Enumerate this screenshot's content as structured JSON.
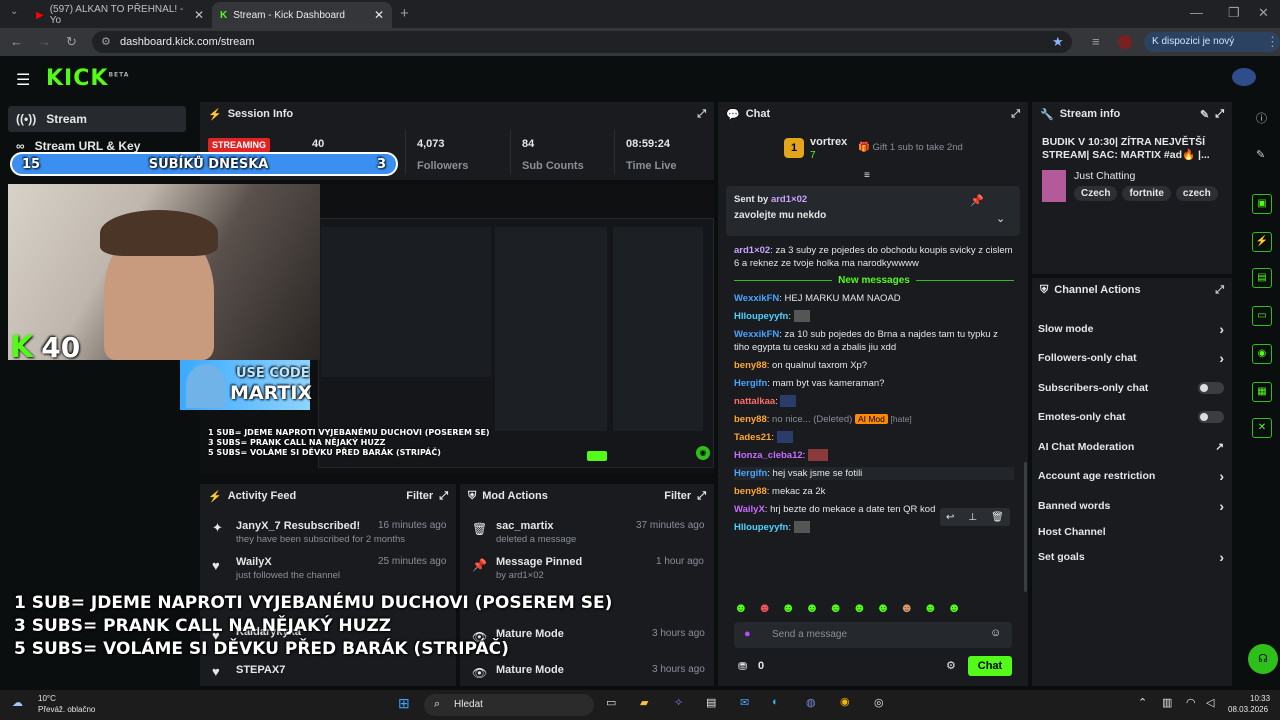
{
  "browser": {
    "tabs": [
      {
        "label": "(597) ALKAN TO PŘEHNAL! - Yo"
      },
      {
        "label": "Stream - Kick Dashboard"
      }
    ],
    "url": "dashboard.kick.com/stream",
    "profile_label": "K dispozici je nový Chrome"
  },
  "sidebar": {
    "items": [
      {
        "label": "Stream"
      },
      {
        "label": "Stream URL & Key"
      }
    ]
  },
  "session": {
    "title": "Session Info",
    "status": "STREAMING",
    "viewers": "40",
    "followers_value": "4,073",
    "followers_label": "Followers",
    "subs_value": "84",
    "subs_label": "Sub Counts",
    "time_value": "08:59:24",
    "time_label": "Time Live"
  },
  "overlay": {
    "sub_goal_left": "15",
    "sub_goal_label": "SUBÍKŮ DNESKA",
    "sub_goal_right": "3",
    "viewer_count": "40",
    "code_line1": "USE CODE",
    "code_line2": "MARTIX",
    "goals": [
      "1 SUB= JDEME NAPROTI VYJEBANÉMU DUCHOVI (POSEREM SE)",
      "3 SUBS= PRANK CALL NA NĚJAKÝ HUZZ",
      "5 SUBS= VOLÁME SI DĚVKU PŘED BARÁK (STRIPÁČ)"
    ],
    "mini_goals": [
      "1 SUB= JDEME NAPROTI VYJEBANÉMU DUCHOVI (POSEREM SE)",
      "3 SUBS= PRANK CALL NA NĚJAKÝ HUZZ",
      "5 SUBS= VOLÁME SI DĚVKU PŘED BARÁK (STRIPÁČ)"
    ]
  },
  "activity": {
    "title": "Activity Feed",
    "filter": "Filter",
    "items": [
      {
        "name": "JanyX_7 Resubscribed!",
        "time": "16 minutes ago",
        "detail": "they have been subscribed for 2 months"
      },
      {
        "name": "WailyX",
        "time": "25 minutes ago",
        "detail": "just followed the channel"
      },
      {
        "name": "Kaldarykyka",
        "time": "",
        "detail": "just followed the channel"
      },
      {
        "name": "STEPAX7",
        "time": "",
        "detail": ""
      }
    ]
  },
  "modactions": {
    "title": "Mod Actions",
    "filter": "Filter",
    "items": [
      {
        "name": "sac_martix",
        "time": "37 minutes ago",
        "detail": "deleted a message"
      },
      {
        "name": "Message Pinned",
        "time": "1 hour ago",
        "detail": "by ard1×02"
      },
      {
        "name": "Mature Mode",
        "time": "3 hours ago",
        "detail": ""
      },
      {
        "name": "Mature Mode",
        "time": "3 hours ago",
        "detail": ""
      }
    ]
  },
  "chat": {
    "title": "Chat",
    "top_gifter": "vortrex",
    "top_gifter_count": "7",
    "gift_prompt": "Gift 1 sub to take 2nd",
    "pinned_sent_by": "Sent by",
    "pinned_user": "ard1×02",
    "pinned_text": "zavolejte mu nekdo",
    "new_messages": "New messages",
    "messages": [
      {
        "user": "ard1×02",
        "text": "za 3 suby ze pojedes do obchodu koupis svicky z cislem 6 a reknez ze tvoje holka ma narodkywwww",
        "color": "#c9a3ff"
      },
      {
        "user": "WexxikFN",
        "text": "HEJ MARKU MAM NAOAD",
        "color": "#4aa3ff"
      },
      {
        "user": "Hlloupeyyfn",
        "text": "",
        "color": "#4ad3ff"
      },
      {
        "user": "WexxikFN",
        "text": "za 10 sub pojedes do Brna a najdes tam tu typku z tiho egypta tu cesku xd a zbalis jiu xdd",
        "color": "#4aa3ff"
      },
      {
        "user": "beny88",
        "text": "on qualnul taxrom Xp?",
        "color": "#ffa630"
      },
      {
        "user": "Hergifn",
        "text": "mam byt vas kameraman?",
        "color": "#4aa3ff"
      },
      {
        "user": "nattalkaa",
        "text": "",
        "color": "#ff6b6b"
      },
      {
        "user": "beny88",
        "text": "no nice... (Deleted)",
        "color": "#ffa630"
      },
      {
        "user": "Tades21",
        "text": "",
        "color": "#ffa630"
      },
      {
        "user": "Honza_cleba12",
        "text": "",
        "color": "#c96bff"
      },
      {
        "user": "Hergifn",
        "text": "hej vsak jsme se fotili",
        "color": "#4aa3ff"
      },
      {
        "user": "beny88",
        "text": "mekac za 2k",
        "color": "#ffa630"
      },
      {
        "user": "WailyX",
        "text": "hrj bezte do mekace a date ten QR kod",
        "color": "#c96bff"
      },
      {
        "user": "Hlloupeyyfn",
        "text": "",
        "color": "#4ad3ff"
      }
    ],
    "ai_mod_badge": "AI Mod",
    "hate_tag": "[hate]",
    "input_placeholder": "Send a message",
    "points": "0",
    "send_label": "Chat"
  },
  "streaminfo": {
    "title": "Stream info",
    "stream_title": "BUDIK V 10:30| ZÍTRA NEJVĚTŠÍ STREAM| SAC: MARTIX #ad🔥 |...",
    "category": "Just Chatting",
    "tags": [
      "Czech",
      "fortnite",
      "czech"
    ]
  },
  "channelactions": {
    "title": "Channel Actions",
    "items": [
      {
        "label": "Slow mode",
        "control": "chevron"
      },
      {
        "label": "Followers-only chat",
        "control": "chevron"
      },
      {
        "label": "Subscribers-only chat",
        "control": "toggle"
      },
      {
        "label": "Emotes-only chat",
        "control": "toggle"
      },
      {
        "label": "AI Chat Moderation",
        "control": "external"
      },
      {
        "label": "Account age restriction",
        "control": "chevron"
      },
      {
        "label": "Banned words",
        "control": "chevron"
      },
      {
        "label": "Host Channel",
        "control": "none"
      },
      {
        "label": "Set goals",
        "control": "chevron"
      }
    ]
  },
  "taskbar": {
    "temp": "10°C",
    "weather": "Převáž. oblačno",
    "search": "Hledat",
    "time": "10:33",
    "date": "08.03.2026"
  },
  "colors": {
    "accent": "#53fc18",
    "panel": "#191b1f",
    "bg": "#0b0e0f",
    "streaming": "#e02424"
  }
}
